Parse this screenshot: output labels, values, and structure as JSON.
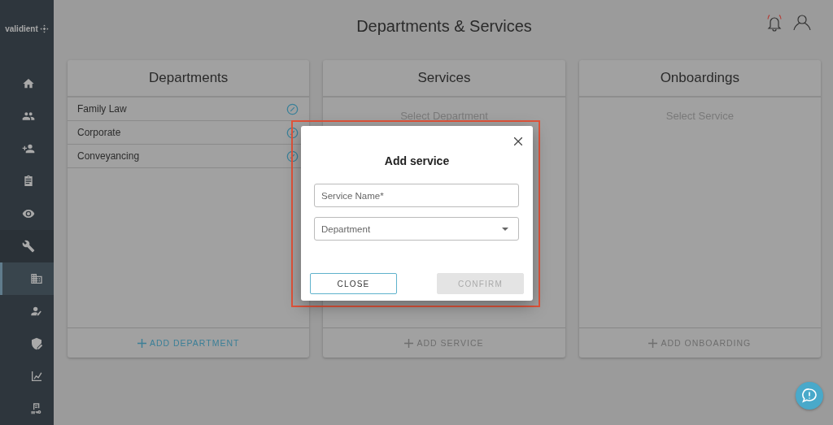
{
  "sidebar": {
    "logo": "validient",
    "items": [
      {
        "kind": "item",
        "selected": false
      },
      {
        "kind": "item",
        "selected": false
      },
      {
        "kind": "item",
        "selected": false
      },
      {
        "kind": "item",
        "selected": false
      },
      {
        "kind": "item",
        "selected": false
      },
      {
        "kind": "section",
        "selected": false
      },
      {
        "kind": "subitem",
        "selected": true
      },
      {
        "kind": "subitem",
        "selected": false
      },
      {
        "kind": "subitem",
        "selected": false
      },
      {
        "kind": "subitem",
        "selected": false
      },
      {
        "kind": "subitem",
        "selected": false
      }
    ]
  },
  "header": {
    "title": "Departments & Services",
    "alert": true
  },
  "panels": [
    {
      "title": "Departments",
      "items": [
        {
          "name": "Family Law"
        },
        {
          "name": "Corporate"
        },
        {
          "name": "Conveyancing"
        }
      ],
      "action": "ADD DEPARTMENT",
      "enabled": true
    },
    {
      "title": "Services",
      "placeholder": "Select Department",
      "action": "ADD SERVICE",
      "enabled": false
    },
    {
      "title": "Onboardings",
      "placeholder": "Select Service",
      "action": "ADD ONBOARDING",
      "enabled": false
    }
  ],
  "dialog": {
    "title": "Add service",
    "highlighted": true,
    "fields": [
      {
        "kind": "text",
        "placeholder": "Service Name*"
      },
      {
        "kind": "select",
        "placeholder": "Department"
      }
    ],
    "buttons": [
      {
        "label": "CLOSE",
        "disabled": false
      },
      {
        "label": "CONFIRM",
        "disabled": true
      }
    ]
  }
}
